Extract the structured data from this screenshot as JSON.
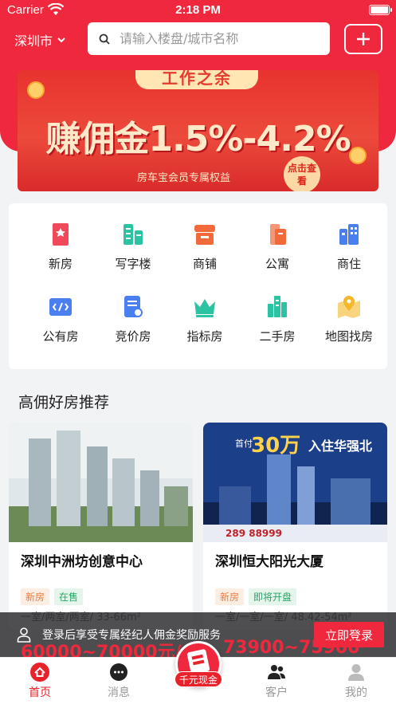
{
  "status": {
    "carrier": "Carrier",
    "time": "2:18 PM"
  },
  "header": {
    "city": "深圳市",
    "search_placeholder": "请输入楼盘/城市名称"
  },
  "banner": {
    "tag": "工作之余",
    "headline": "赚佣金1.5%-4.2%",
    "sub": "房车宝会员专属权益",
    "cta": "点击查看"
  },
  "categories": [
    {
      "label": "新房",
      "icon": "bookmark-icon",
      "color": "#f04a5a"
    },
    {
      "label": "写字楼",
      "icon": "office-building-icon",
      "color": "#2cc3a3"
    },
    {
      "label": "商铺",
      "icon": "storefront-icon",
      "color": "#f26a3a"
    },
    {
      "label": "公寓",
      "icon": "apartment-icon",
      "color": "#f26a3a"
    },
    {
      "label": "商住",
      "icon": "buildings-icon",
      "color": "#4a7ff0"
    },
    {
      "label": "公有房",
      "icon": "code-screen-icon",
      "color": "#4a7ff0"
    },
    {
      "label": "竞价房",
      "icon": "document-search-icon",
      "color": "#4a7ff0"
    },
    {
      "label": "指标房",
      "icon": "crown-icon",
      "color": "#2cc3a3"
    },
    {
      "label": "二手房",
      "icon": "city-icon",
      "color": "#2cc3a3"
    },
    {
      "label": "地图找房",
      "icon": "map-pin-icon",
      "color": "#f5b82a"
    }
  ],
  "section": {
    "title": "高佣好房推荐"
  },
  "properties": [
    {
      "name": "深圳中洲坊创意中心",
      "badges": [
        "新房",
        "在售"
      ],
      "info": "一室/两室/两室/  33-66m²",
      "price": "60000~70000元/m²"
    },
    {
      "name": "深圳恒大阳光大厦",
      "badges": [
        "新房",
        "即将开盘"
      ],
      "info": "一室/一室/一室/  48.42-54m²",
      "price": "73900~75900元/m²"
    }
  ],
  "ad_overlay": {
    "price_highlight": "30万",
    "headline_suffix": "入住华强北",
    "phone": "289 88999"
  },
  "login_bar": {
    "message": "登录后享受专属经纪人佣金奖励服务",
    "button": "立即登录"
  },
  "tabbar": {
    "tabs": [
      {
        "label": "首页",
        "icon": "home-icon"
      },
      {
        "label": "消息",
        "icon": "chat-icon"
      },
      {
        "label": "客户",
        "icon": "customers-icon"
      },
      {
        "label": "我的",
        "icon": "profile-icon"
      }
    ],
    "center_label": "千元现金"
  }
}
